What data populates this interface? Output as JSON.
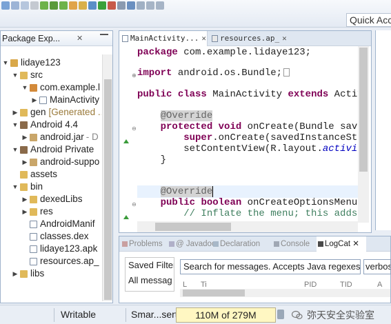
{
  "toolbar": {
    "quick_access": "Quick Acce"
  },
  "package_explorer": {
    "tab_label": "Package Exp...",
    "close": "✕",
    "items": [
      {
        "label": "lidaye123",
        "suffix": ""
      },
      {
        "label": "src",
        "suffix": ""
      },
      {
        "label": "com.example.l",
        "suffix": ""
      },
      {
        "label": "MainActivity",
        "suffix": ""
      },
      {
        "label": "gen",
        "suffix": "[Generated ..."
      },
      {
        "label": "Android 4.4",
        "suffix": ""
      },
      {
        "label": "android.jar",
        "suffix": "- D"
      },
      {
        "label": "Android Private",
        "suffix": ""
      },
      {
        "label": "android-suppo",
        "suffix": ""
      },
      {
        "label": "assets",
        "suffix": ""
      },
      {
        "label": "bin",
        "suffix": ""
      },
      {
        "label": "dexedLibs",
        "suffix": ""
      },
      {
        "label": "res",
        "suffix": ""
      },
      {
        "label": "AndroidManif",
        "suffix": ""
      },
      {
        "label": "classes.dex",
        "suffix": ""
      },
      {
        "label": "lidaye123.apk",
        "suffix": ""
      },
      {
        "label": "resources.ap_",
        "suffix": ""
      },
      {
        "label": "libs",
        "suffix": ""
      }
    ]
  },
  "editor": {
    "tabs": [
      {
        "label": "MainActivity...",
        "close": "✕"
      },
      {
        "label": "resources.ap_",
        "close": "✕"
      }
    ],
    "code": {
      "l1_kw": "package",
      "l1_rest": " com.example.lidaye123;",
      "l2_kw": "import",
      "l2_rest": " android.os.Bundle;",
      "l3_kw1": "public",
      "l3_kw2": "class",
      "l3_name": " MainActivity ",
      "l3_kw3": "extends",
      "l3_rest": " Activ",
      "l4_ann": "@Override",
      "l5_kw1": "protected",
      "l5_kw2": "void",
      "l5_rest": " onCreate(Bundle save",
      "l6_kw": "super",
      "l6_rest": ".onCreate(savedInstanceSta",
      "l7_pre": "setContentView(R.layout.",
      "l7_field": "activit",
      "l8": "}",
      "l9_ann": "@Override",
      "l10_kw1": "public",
      "l10_kw2": "boolean",
      "l10_rest": " onCreateOptionsMenu(",
      "l11_cmt": "// Inflate the menu; this adds"
    }
  },
  "bottom": {
    "tabs": [
      "Problems",
      "@ Javadoc",
      "Declaration",
      "Console",
      "LogCat"
    ],
    "logcat_close": "✕",
    "saved_filter": "Saved Filter",
    "all_messages": "All messag",
    "search_placeholder": "Search for messages. Accepts Java regexes.",
    "level": "verbos",
    "col_l": "L",
    "col_ti": "Ti",
    "col_pid": "PID",
    "col_tid": "TID",
    "col_a": "A"
  },
  "status": {
    "writable": "Writable",
    "insert_mode": "Smar...sert",
    "heap": "110M of 279M",
    "watermark": "弥天安全实验室"
  },
  "colors": {
    "keyword": "#7f0055",
    "comment": "#3f7f5f",
    "annotation": "#646464",
    "field": "#0000c0"
  }
}
